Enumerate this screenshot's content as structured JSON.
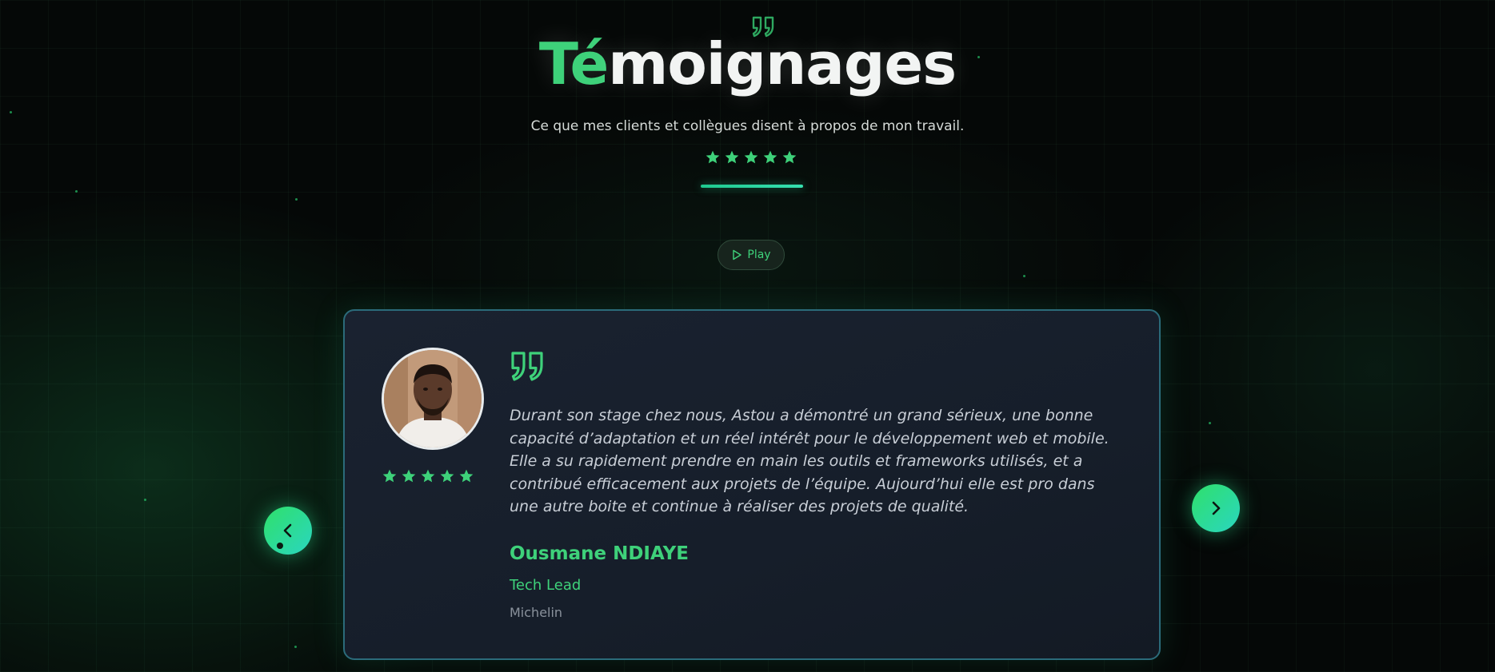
{
  "section": {
    "title_accent": "Té",
    "title_rest": "moignages",
    "subtitle": "Ce que mes clients et collègues disent à propos de mon travail.",
    "rating_stars": 5
  },
  "controls": {
    "play_label": "Play"
  },
  "testimonial": {
    "text": "Durant son stage chez nous, Astou a démontré un grand sérieux, une bonne capacité d’adaptation et un réel intérêt pour le développement web et mobile. Elle a su rapidement prendre en main les outils et frameworks utilisés, et a contribué efficacement aux projets de l’équipe. Aujourd’hui elle est pro dans une autre boite et continue à réaliser des projets de qualité.",
    "name": "Ousmane NDIAYE",
    "role": "Tech Lead",
    "company": "Michelin",
    "rating_stars": 5
  },
  "colors": {
    "accent": "#3ed17a",
    "card_border": "#2b6b7a",
    "background": "#050807"
  },
  "icons": {
    "quote": "quote-icon",
    "star": "star-icon",
    "play": "play-icon",
    "prev": "chevron-left-icon",
    "next": "chevron-right-icon"
  }
}
